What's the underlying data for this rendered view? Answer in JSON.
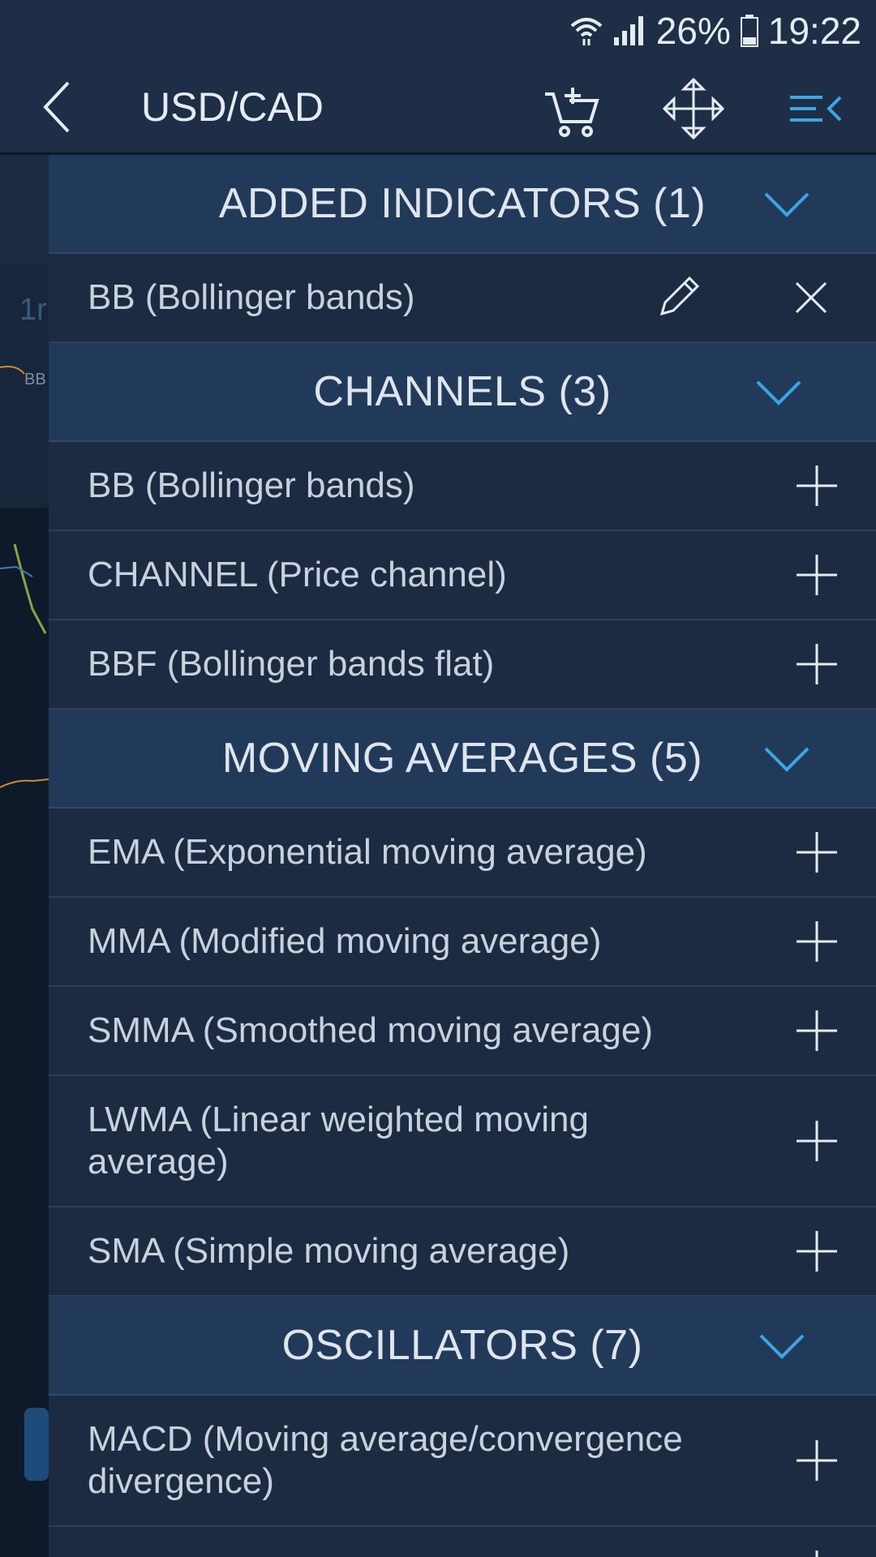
{
  "status_bar": {
    "battery": "26%",
    "time": "19:22"
  },
  "app_bar": {
    "title": "USD/CAD",
    "icons": [
      "back-icon",
      "cart-add-icon",
      "move-arrows-icon",
      "menu-collapse-icon"
    ]
  },
  "background": {
    "ghost_text_1": "1r",
    "ghost_text_2": "BB"
  },
  "sections": {
    "added": {
      "title": "ADDED INDICATORS (1)",
      "items": [
        {
          "label": "BB (Bollinger bands)"
        }
      ]
    },
    "channels": {
      "title": "CHANNELS (3)",
      "items": [
        {
          "label": "BB (Bollinger bands)"
        },
        {
          "label": "CHANNEL (Price channel)"
        },
        {
          "label": "BBF (Bollinger bands flat)"
        }
      ]
    },
    "moving_averages": {
      "title": "MOVING AVERAGES (5)",
      "items": [
        {
          "label": "EMA (Exponential moving average)"
        },
        {
          "label": "MMA (Modified moving average)"
        },
        {
          "label": "SMMA (Smoothed moving average)"
        },
        {
          "label": "LWMA (Linear weighted moving average)"
        },
        {
          "label": "SMA (Simple moving average)"
        }
      ]
    },
    "oscillators": {
      "title": "OSCILLATORS (7)",
      "items": [
        {
          "label": "MACD (Moving average/convergence divergence)"
        }
      ]
    }
  },
  "colors": {
    "accent": "#3aa6e6",
    "header_bg": "#223a5a",
    "row_bg": "#1c2b41",
    "app_bar_bg": "#1d2e46"
  }
}
